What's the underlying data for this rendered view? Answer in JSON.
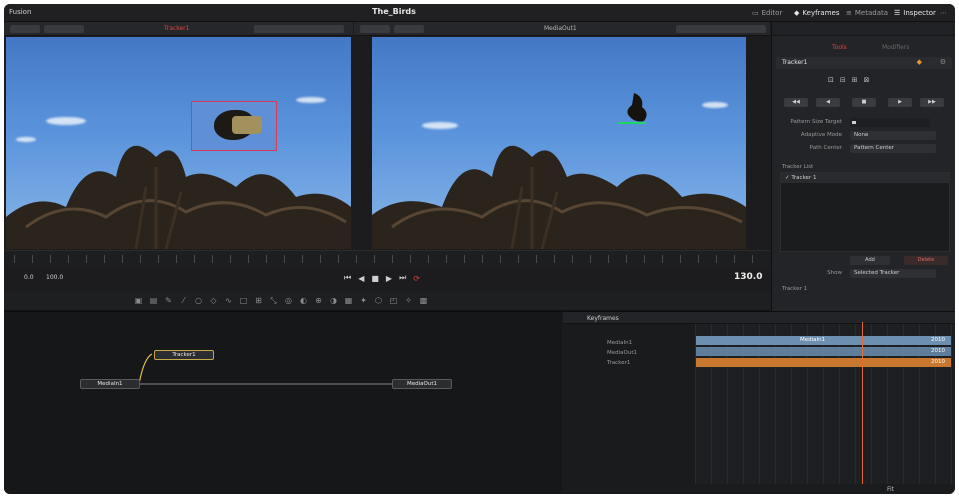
{
  "window": {
    "app_title": "Fusion",
    "project_title": "The_Birds",
    "toolbar": [
      {
        "label": "Editor",
        "icon": "monitor-icon",
        "active": false
      },
      {
        "label": "Keyframes",
        "icon": "keyframe-icon",
        "active": true
      },
      {
        "label": "Metadata",
        "icon": "metadata-icon",
        "active": false
      },
      {
        "label": "Inspector",
        "icon": "sliders-icon",
        "active": true
      }
    ]
  },
  "viewer_left": {
    "node_name": "Tracker1"
  },
  "viewer_right": {
    "node_name": "MediaOut1"
  },
  "transport": {
    "start_frame": "0.0",
    "duration": "100.0",
    "current_frame": "130.0"
  },
  "inspector": {
    "tabs": [
      "Tools",
      "Modifiers"
    ],
    "node_title": "Tracker1",
    "track_buttons": [
      "◀◀",
      "◀",
      "■",
      "▶",
      "▶▶"
    ],
    "rows": [
      {
        "label": "Pattern Size Target",
        "value": ""
      },
      {
        "label": "Adaptive Mode",
        "value": "None"
      },
      {
        "label": "Path Center",
        "value": "Pattern Center"
      }
    ],
    "list_header": "Tracker List",
    "list_items": [
      "Tracker 1"
    ],
    "add_button": "Add",
    "delete_button": "Delete",
    "show_label": "Show",
    "show_value": "Selected Tracker",
    "footer_label": "Tracker 1"
  },
  "nodes": {
    "mediain": "MediaIn1",
    "tracker": "Tracker1",
    "mediaout": "MediaOut1"
  },
  "keyframes": {
    "title": "Keyframes",
    "items": [
      "MediaIn1",
      "MediaOut1",
      "Tracker1"
    ],
    "bar_label": "MediaIn1",
    "end_values": [
      "2010",
      "2010",
      "2010"
    ],
    "bottom_right": "Fit",
    "colors": {
      "bar_blue": "#6d8fb0",
      "bar_orange": "#c8782e",
      "accent": "#e0443a"
    }
  }
}
